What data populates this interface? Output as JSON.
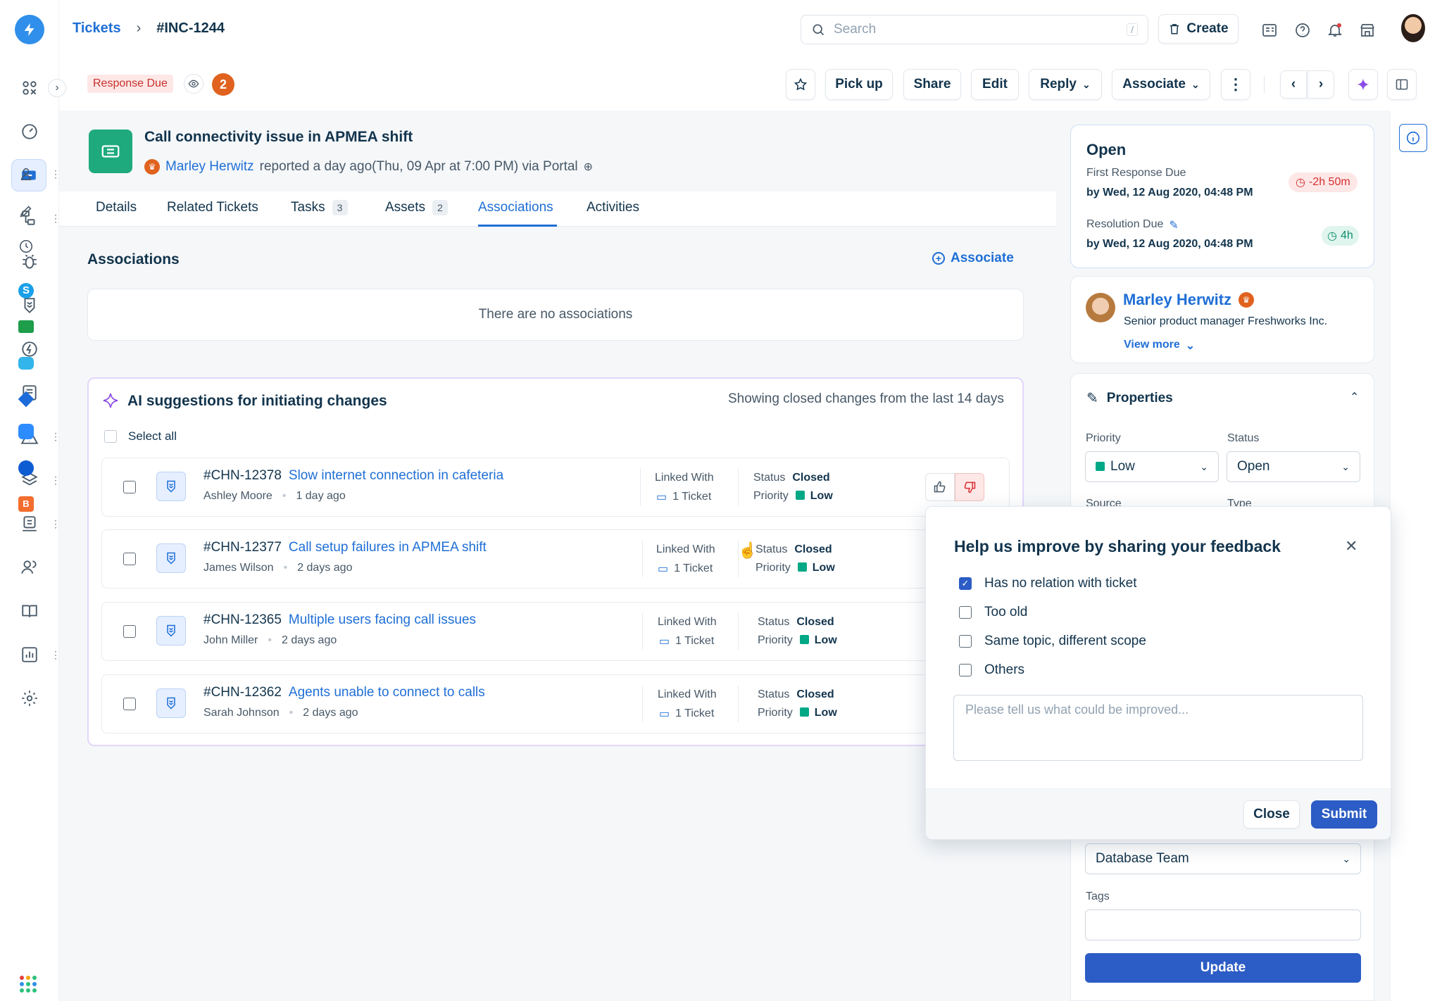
{
  "breadcrumb": {
    "root": "Tickets",
    "current": "#INC-1244"
  },
  "search": {
    "placeholder": "Search",
    "shortcut": "/"
  },
  "top_actions": {
    "create": "Create"
  },
  "ticket_bar": {
    "badge": "Response Due",
    "watchers": "2",
    "buttons": {
      "pick_up": "Pick up",
      "share": "Share",
      "edit": "Edit",
      "reply": "Reply",
      "associate": "Associate"
    }
  },
  "ticket": {
    "title": "Call connectivity issue in APMEA shift",
    "requester": "Marley Herwitz",
    "meta": "reported a day ago(Thu, 09 Apr at 7:00 PM) via Portal"
  },
  "tabs": [
    {
      "label": "Details"
    },
    {
      "label": "Related Tickets"
    },
    {
      "label": "Tasks",
      "count": "3"
    },
    {
      "label": "Assets",
      "count": "2"
    },
    {
      "label": "Associations",
      "active": true
    },
    {
      "label": "Activities"
    }
  ],
  "associations": {
    "heading": "Associations",
    "associate_link": "Associate",
    "empty": "There are no associations"
  },
  "ai": {
    "title": "AI suggestions for initiating changes",
    "subtitle": "Showing closed changes from the last 14 days",
    "select_all": "Select all",
    "linked_label": "Linked With",
    "status_label": "Status",
    "priority_label": "Priority",
    "items": [
      {
        "id": "#CHN-12378",
        "title": "Slow internet connection in cafeteria",
        "author": "Ashley Moore",
        "age": "1 day ago",
        "linked": "1 Ticket",
        "status": "Closed",
        "priority": "Low"
      },
      {
        "id": "#CHN-12377",
        "title": "Call setup failures in APMEA shift",
        "author": "James Wilson",
        "age": "2 days ago",
        "linked": "1 Ticket",
        "status": "Closed",
        "priority": "Low"
      },
      {
        "id": "#CHN-12365",
        "title": "Multiple users facing call issues",
        "author": "John Miller",
        "age": "2 days ago",
        "linked": "1 Ticket",
        "status": "Closed",
        "priority": "Low"
      },
      {
        "id": "#CHN-12362",
        "title": "Agents unable to connect to calls",
        "author": "Sarah Johnson",
        "age": "2 days ago",
        "linked": "1 Ticket",
        "status": "Closed",
        "priority": "Low"
      }
    ]
  },
  "sla": {
    "state": "Open",
    "first_label": "First Response Due",
    "first_date": "by Wed, 12 Aug 2020, 04:48 PM",
    "first_timer": "-2h 50m",
    "res_label": "Resolution Due",
    "res_date": "by Wed, 12 Aug 2020, 04:48 PM",
    "res_timer": "4h"
  },
  "requester": {
    "name": "Marley Herwitz",
    "role": "Senior product manager Freshworks Inc.",
    "view_more": "View more"
  },
  "properties": {
    "title": "Properties",
    "priority_label": "Priority",
    "priority_value": "Low",
    "status_label": "Status",
    "status_value": "Open",
    "source_label": "Source",
    "type_label": "Type",
    "group_value": "Database Team",
    "tags_label": "Tags",
    "update": "Update"
  },
  "feedback": {
    "title": "Help us improve by sharing your feedback",
    "options": [
      {
        "label": "Has no relation with ticket",
        "checked": true
      },
      {
        "label": "Too old",
        "checked": false
      },
      {
        "label": "Same topic, different scope",
        "checked": false
      },
      {
        "label": "Others",
        "checked": false
      }
    ],
    "placeholder": "Please tell us what could be improved...",
    "close": "Close",
    "submit": "Submit"
  },
  "colors": {
    "primary": "#2c5cc5",
    "brand": "#1f6fd6",
    "green": "#00a886",
    "danger": "#d72d30"
  }
}
